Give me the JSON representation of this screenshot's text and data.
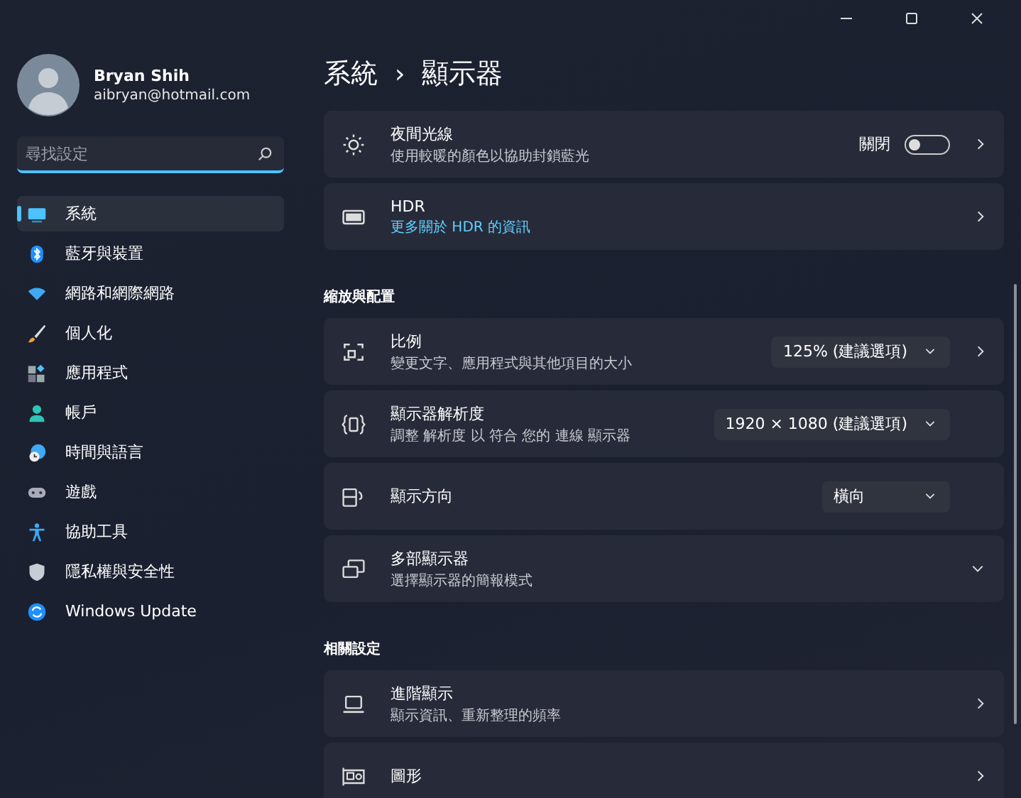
{
  "profile": {
    "name": "Bryan Shih",
    "email": "aibryan@hotmail.com"
  },
  "search": {
    "placeholder": "尋找設定"
  },
  "nav": [
    {
      "kind": "system",
      "label": "系統",
      "selected": true
    },
    {
      "kind": "bluetooth",
      "label": "藍牙與裝置",
      "selected": false
    },
    {
      "kind": "network",
      "label": "網路和網際網路",
      "selected": false
    },
    {
      "kind": "personalize",
      "label": "個人化",
      "selected": false
    },
    {
      "kind": "apps",
      "label": "應用程式",
      "selected": false
    },
    {
      "kind": "accounts",
      "label": "帳戶",
      "selected": false
    },
    {
      "kind": "time",
      "label": "時間與語言",
      "selected": false
    },
    {
      "kind": "gaming",
      "label": "遊戲",
      "selected": false
    },
    {
      "kind": "accessibility",
      "label": "協助工具",
      "selected": false
    },
    {
      "kind": "privacy",
      "label": "隱私權與安全性",
      "selected": false
    },
    {
      "kind": "update",
      "label": "Windows Update",
      "selected": false
    }
  ],
  "breadcrumb": {
    "parent": "系統",
    "separator": "›",
    "current": "顯示器"
  },
  "sections": [
    {
      "cards": [
        {
          "kind": "brightness",
          "title": "夜間光線",
          "subtitle": "使用較暖的顏色以協助封鎖藍光",
          "control": {
            "kind": "toggle",
            "label": "關閉",
            "on": false
          },
          "opens_page": true,
          "expandable": false
        },
        {
          "kind": "hdr",
          "title": "HDR",
          "link": "更多關於 HDR 的資訊",
          "opens_page": true,
          "expandable": false
        }
      ]
    },
    {
      "heading": "縮放與配置",
      "cards": [
        {
          "kind": "scale",
          "title": "比例",
          "subtitle": "變更文字、應用程式與其他項目的大小",
          "control": {
            "kind": "dropdown",
            "value": "125% (建議選項)"
          },
          "opens_page": true,
          "expandable": false
        },
        {
          "kind": "resolution",
          "title": "顯示器解析度",
          "subtitle": "調整 解析度 以 符合 您的 連線 顯示器",
          "control": {
            "kind": "dropdown",
            "value": "1920 × 1080 (建議選項)"
          },
          "opens_page": false,
          "expandable": false
        },
        {
          "kind": "orientation",
          "title": "顯示方向",
          "control": {
            "kind": "dropdown",
            "value": "橫向"
          },
          "opens_page": false,
          "expandable": false
        },
        {
          "kind": "multi",
          "title": "多部顯示器",
          "subtitle": "選擇顯示器的簡報模式",
          "opens_page": false,
          "expandable": true
        }
      ]
    },
    {
      "heading": "相關設定",
      "cards": [
        {
          "kind": "laptop",
          "title": "進階顯示",
          "subtitle": "顯示資訊、重新整理的頻率",
          "opens_page": true,
          "expandable": false
        },
        {
          "kind": "graphics",
          "title": "圖形",
          "opens_page": true,
          "expandable": false
        }
      ]
    }
  ]
}
